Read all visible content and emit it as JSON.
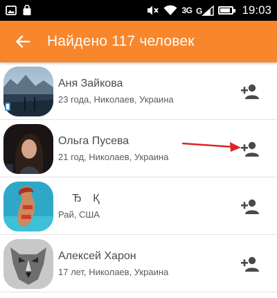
{
  "status_bar": {
    "network_label": "3G",
    "time": "19:03"
  },
  "toolbar": {
    "title": "Найдено 117 человек"
  },
  "results": [
    {
      "name": "Аня Зайкова",
      "details": "23 года, Николаев, Украина",
      "avatar": "lake-landscape"
    },
    {
      "name": "Ольга Пусева",
      "details": "21 год, Николаев, Украина",
      "avatar": "portrait-dark-hair"
    },
    {
      "name": "Ђ Қ",
      "details": "Рай, США",
      "avatar": "beach-photo"
    },
    {
      "name": "Алексей Харон",
      "details": "17 лет, Николаев, Украина",
      "avatar": "wolf-drawing"
    }
  ],
  "colors": {
    "accent": "#f7862c",
    "annotation_arrow": "#d8262b",
    "add_icon": "#4a4a4a"
  }
}
